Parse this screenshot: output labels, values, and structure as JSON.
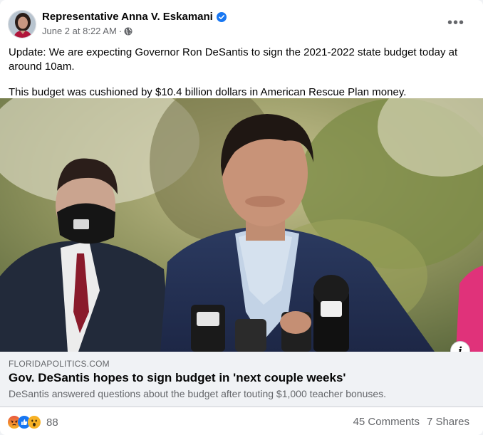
{
  "post": {
    "author": "Representative Anna V. Eskamani",
    "timestamp": "June 2 at 8:22 AM",
    "separator": "·",
    "privacy_icon": "globe-icon",
    "verified_icon": "verified-badge-icon",
    "more_icon": "more-options-icon",
    "more_label": "•••",
    "text": [
      "Update: We are expecting Governor Ron DeSantis to sign the 2021-2022 state budget today at around 10am.",
      "This budget was cushioned by $10.4 billion dollars in American Rescue Plan money."
    ]
  },
  "link_preview": {
    "domain": "FLORIDAPOLITICS.COM",
    "headline": "Gov. DeSantis hopes to sign budget in 'next couple weeks'",
    "description": "DeSantis answered questions about the budget after touting $1,000 teacher bonuses.",
    "info_label": "i"
  },
  "engagement": {
    "reaction_icons": [
      "angry-reaction-icon",
      "like-reaction-icon",
      "wow-reaction-icon"
    ],
    "reaction_count": "88",
    "comments": "45 Comments",
    "shares": "7 Shares"
  },
  "colors": {
    "primary_text": "#050505",
    "secondary_text": "#65676b",
    "verified_blue": "#1877f2",
    "link_bg": "#f0f2f5"
  }
}
